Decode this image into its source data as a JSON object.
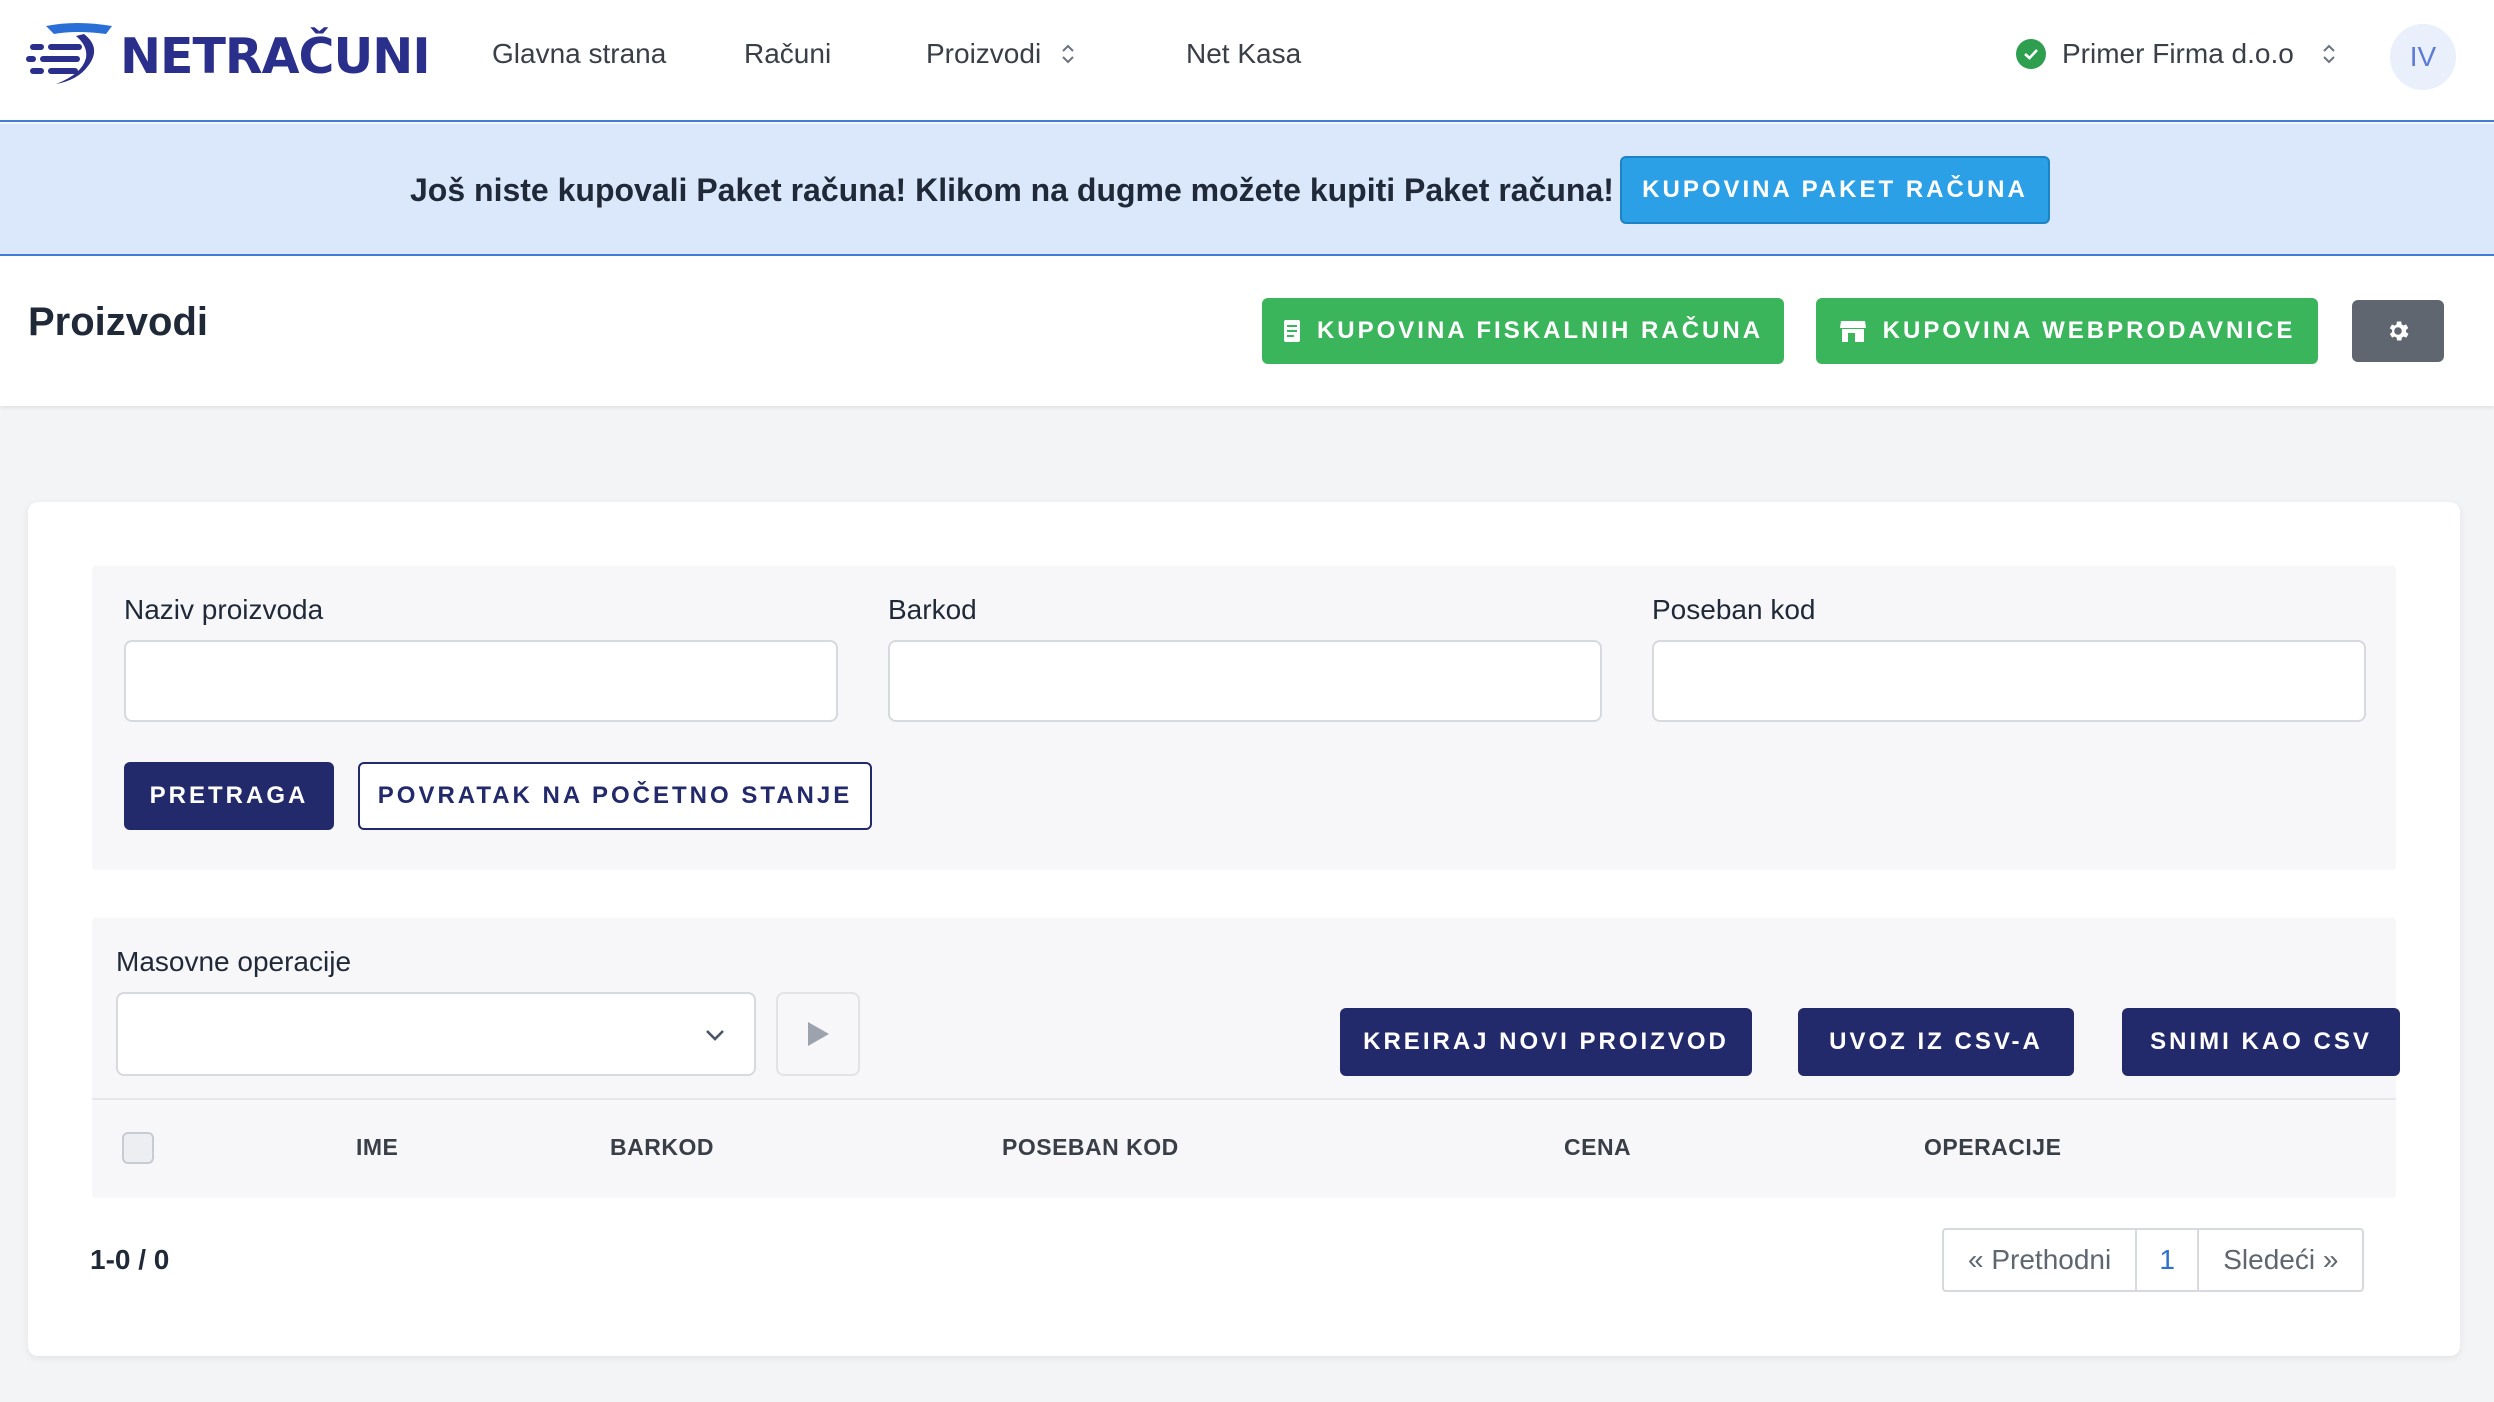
{
  "brand": {
    "name": "NETRAČUNI",
    "color": "#2a2f8c"
  },
  "nav": {
    "items": [
      {
        "label": "Glavna strana"
      },
      {
        "label": "Računi"
      },
      {
        "label": "Proizvodi"
      },
      {
        "label": "Net Kasa"
      }
    ],
    "company": "Primer Firma d.o.o",
    "avatar_initials": "IV"
  },
  "banner": {
    "message": "Još niste kupovali Paket računa! Klikom na dugme možete kupiti Paket računa!",
    "button_label": "KUPOVINA PAKET RAČUNA"
  },
  "header": {
    "title": "Proizvodi",
    "buy_fiscal_label": "KUPOVINA FISKALNIH RAČUNA",
    "buy_webshop_label": "KUPOVINA WEBPRODAVNICE",
    "settings_icon": "gear-icon"
  },
  "filters": {
    "name_label": "Naziv proizvoda",
    "name_value": "",
    "barcode_label": "Barkod",
    "barcode_value": "",
    "special_code_label": "Poseban kod",
    "special_code_value": "",
    "search_label": "PRETRAGA",
    "reset_label": "POVRATAK NA POČETNO STANJE"
  },
  "operations": {
    "mass_label": "Masovne operacije",
    "mass_selected": "",
    "create_label": "KREIRAJ NOVI PROIZVOD",
    "import_label": "UVOZ IZ CSV-A",
    "export_label": "SNIMI KAO CSV"
  },
  "table": {
    "columns": [
      "IME",
      "BARKOD",
      "POSEBAN KOD",
      "CENA",
      "OPERACIJE"
    ],
    "rows": []
  },
  "pagination": {
    "summary": "1-0 / 0",
    "prev_label": "« Prethodni",
    "current_page": "1",
    "next_label": "Sledeći »"
  },
  "colors": {
    "accent_blue": "#2ba0e6",
    "green": "#3bb55c",
    "navy": "#232a6b",
    "banner_bg": "#dbe7fb",
    "status_ok": "#2e9e4f"
  }
}
